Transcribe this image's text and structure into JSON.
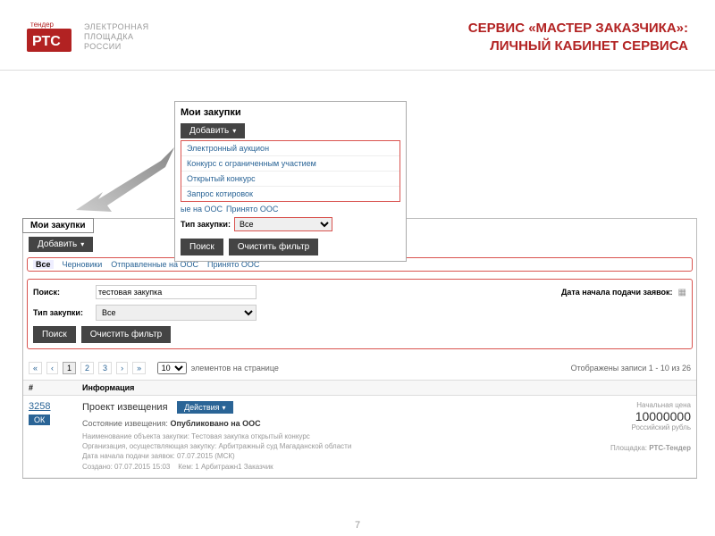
{
  "header": {
    "logo_top": "тендер",
    "logo_main": "РТС",
    "logo_sub1": "ЭЛЕКТРОННАЯ",
    "logo_sub2": "ПЛОЩАДКА",
    "logo_sub3": "РОССИИ",
    "title_line1": "СЕРВИС «МАСТЕР ЗАКАЗЧИКА»:",
    "title_line2": "ЛИЧНЫЙ КАБИНЕТ СЕРВИСА"
  },
  "popup": {
    "title": "Мои закупки",
    "add_label": "Добавить",
    "menu": [
      "Электронный аукцион",
      "Конкурс с ограниченным участием",
      "Открытый конкурс",
      "Запрос котировок"
    ],
    "tab_sent": "ые на ООС",
    "tab_accepted": "Принято ООС",
    "type_label": "Тип закупки:",
    "type_value": "Все",
    "search_btn": "Поиск",
    "clear_btn": "Очистить фильтр"
  },
  "main": {
    "my_tab": "Мои закупки",
    "add_label": "Добавить",
    "tabs": {
      "all": "Все",
      "drafts": "Черновики",
      "sent": "Отправленные на ООС",
      "accepted": "Принято ООС"
    },
    "filter": {
      "search_label": "Поиск:",
      "search_value": "тестовая закупка",
      "date_label": "Дата начала подачи заявок:",
      "type_label": "Тип закупки:",
      "type_value": "Все",
      "search_btn": "Поиск",
      "clear_btn": "Очистить фильтр"
    },
    "pager": {
      "pages": [
        "1",
        "2",
        "3"
      ],
      "per_page": "10",
      "per_page_label": "элементов на странице",
      "summary": "Отображены записи 1 - 10 из 26"
    },
    "table": {
      "col_num": "#",
      "col_info": "Информация",
      "row": {
        "id": "3258",
        "badge": "ОК",
        "title": "Проект извещения",
        "actions": "Действия",
        "state_label": "Состояние извещения:",
        "state_value": "Опубликовано на ООС",
        "meta1": "Наименование объекта закупки:   Тестовая закупка открытый конкурс",
        "meta2": "Организация, осуществляющая закупку: Арбитражный суд Магаданской области",
        "meta3": "Дата начала подачи заявок:   07.07.2015 (МСК)",
        "meta4_left": "Создано: 07.07.2015 15:03",
        "meta4_right": "Кем: 1 Арбитражн1 Заказчик",
        "price_label": "Начальная цена",
        "price_value": "10000000",
        "price_currency": "Российский рубль",
        "platform_label": "Площадка:",
        "platform_value": "РТС-Тендер"
      }
    }
  },
  "page_number": "7"
}
